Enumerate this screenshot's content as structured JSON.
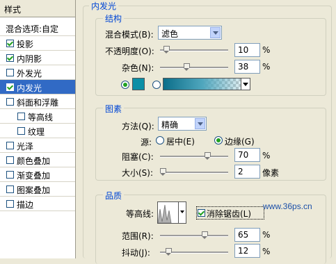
{
  "sidebar": {
    "header": "样式",
    "items": [
      {
        "label": "混合选项:自定",
        "checkbox": false,
        "checked": false,
        "selected": false
      },
      {
        "label": "投影",
        "checkbox": true,
        "checked": true,
        "selected": false
      },
      {
        "label": "内阴影",
        "checkbox": true,
        "checked": true,
        "selected": false
      },
      {
        "label": "外发光",
        "checkbox": true,
        "checked": false,
        "selected": false
      },
      {
        "label": "内发光",
        "checkbox": true,
        "checked": true,
        "selected": true
      },
      {
        "label": "斜面和浮雕",
        "checkbox": true,
        "checked": false,
        "selected": false
      },
      {
        "label": "等高线",
        "checkbox": true,
        "checked": false,
        "selected": false,
        "indent": true
      },
      {
        "label": "纹理",
        "checkbox": true,
        "checked": false,
        "selected": false,
        "indent": true
      },
      {
        "label": "光泽",
        "checkbox": true,
        "checked": false,
        "selected": false
      },
      {
        "label": "颜色叠加",
        "checkbox": true,
        "checked": false,
        "selected": false
      },
      {
        "label": "渐变叠加",
        "checkbox": true,
        "checked": false,
        "selected": false
      },
      {
        "label": "图案叠加",
        "checkbox": true,
        "checked": false,
        "selected": false
      },
      {
        "label": "描边",
        "checkbox": true,
        "checked": false,
        "selected": false
      }
    ]
  },
  "panel": {
    "title": "内发光",
    "structure": {
      "legend": "结构",
      "blend_mode_label": "混合模式(B):",
      "blend_mode_value": "滤色",
      "opacity_label": "不透明度(O):",
      "opacity_value": "10",
      "opacity_unit": "%",
      "noise_label": "杂色(N):",
      "noise_value": "38",
      "noise_unit": "%",
      "color": "#0c8fa6"
    },
    "elements": {
      "legend": "图素",
      "method_label": "方法(Q):",
      "method_value": "精确",
      "source_label": "源:",
      "source_center": "居中(E)",
      "source_edge": "边缘(G)",
      "choke_label": "阻塞(C):",
      "choke_value": "70",
      "choke_unit": "%",
      "size_label": "大小(S):",
      "size_value": "2",
      "size_unit": "像素"
    },
    "quality": {
      "legend": "品质",
      "contour_label": "等高线:",
      "antialias_label": "消除锯齿(L)",
      "range_label": "范围(R):",
      "range_value": "65",
      "range_unit": "%",
      "jitter_label": "抖动(J):",
      "jitter_value": "12",
      "jitter_unit": "%"
    },
    "watermark": "www.36ps.cn"
  }
}
